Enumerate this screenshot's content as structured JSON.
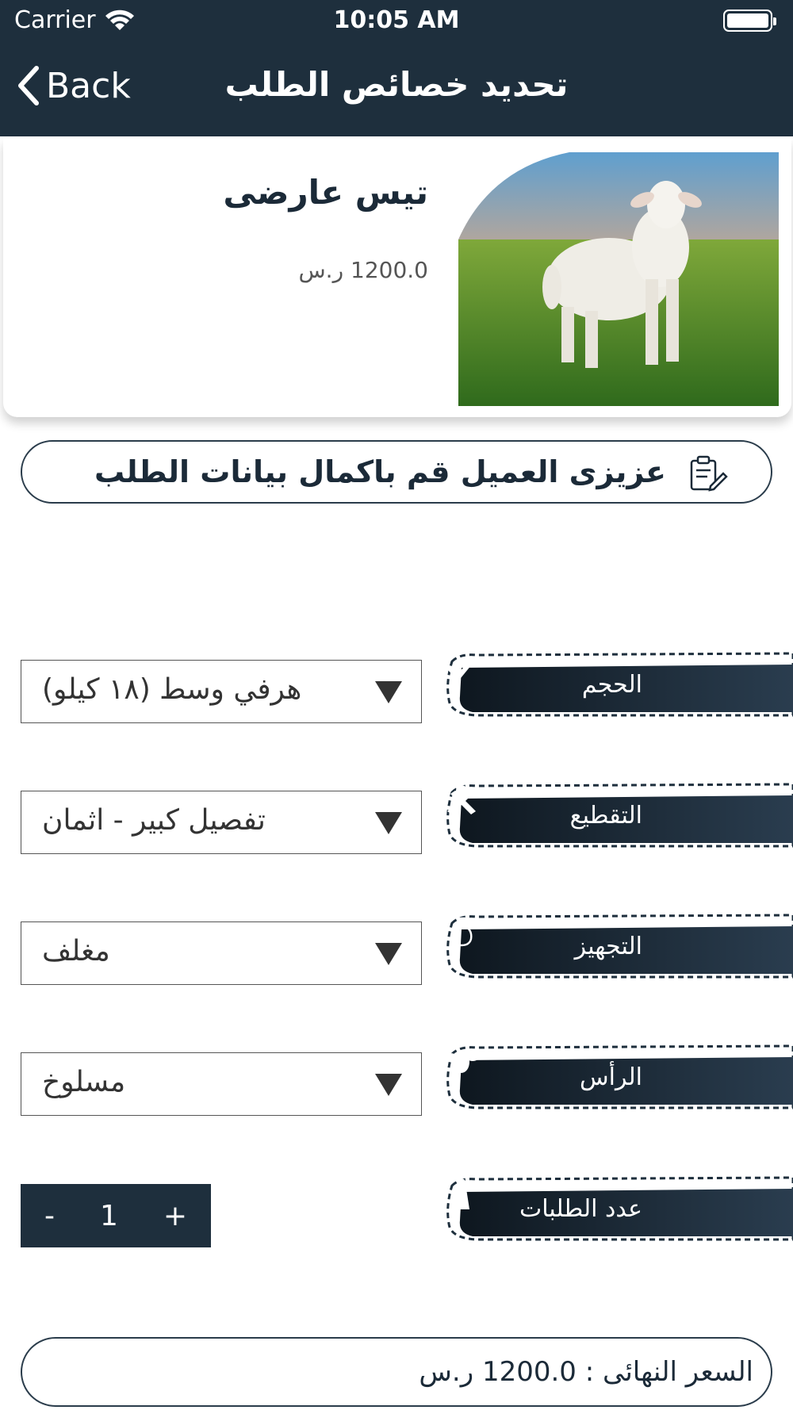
{
  "status": {
    "carrier": "Carrier",
    "time": "10:05 AM"
  },
  "nav": {
    "back_label": "Back",
    "title": "تحديد خصائص الطلب"
  },
  "product": {
    "name": "تيس عارضى",
    "price": "1200.0 ر.س"
  },
  "notice": {
    "text": "عزيزى العميل قم باكمال بيانات الطلب"
  },
  "options": [
    {
      "label": "الحجم",
      "value": "هرفي وسط (١٨ كيلو)",
      "icon": "checkmark-icon"
    },
    {
      "label": "التقطيع",
      "value": "تفصيل كبير - اثمان",
      "icon": "knives-icon"
    },
    {
      "label": "التجهيز",
      "value": "مغلف",
      "icon": "bag-icon"
    },
    {
      "label": "الرأس",
      "value": "مسلوخ",
      "icon": "sheep-head-icon"
    }
  ],
  "quantity": {
    "label": "عدد الطلبات",
    "minus": "-",
    "value": "1",
    "plus": "+",
    "icon": "person-icon"
  },
  "total": {
    "text": "السعر النهائى :  1200.0 ر.س"
  },
  "colors": {
    "primary": "#1e2f3d",
    "text": "#1b2a38"
  }
}
